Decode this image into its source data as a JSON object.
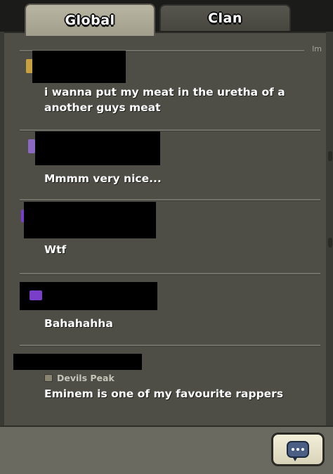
{
  "tabs": [
    {
      "label": "Global",
      "active": true
    },
    {
      "label": "Clan",
      "active": false
    }
  ],
  "chat": {
    "timestamp": "lm",
    "messages": [
      {
        "text": "i wanna put my meat in the uretha of a another guys meat",
        "sender_redacted": true,
        "clan": ""
      },
      {
        "text": "Mmmm very nice...",
        "sender_redacted": true,
        "clan": ""
      },
      {
        "text": "Wtf",
        "sender_redacted": true,
        "clan": ""
      },
      {
        "text": "Bahahahha",
        "sender_redacted": true,
        "clan": ""
      },
      {
        "text": "Eminem is one of my favourite rappers",
        "sender_redacted": true,
        "clan": "Devils Peak"
      }
    ]
  },
  "footer": {
    "chat_button_icon": "chat-bubble-icon"
  },
  "colors": {
    "panel": "#4e4e47",
    "active_tab": "#b9b5a3",
    "inactive_tab": "#56564e",
    "footer": "#6a6a60",
    "chat_button": "#f3efd9",
    "bubble": "#4a5f83"
  }
}
